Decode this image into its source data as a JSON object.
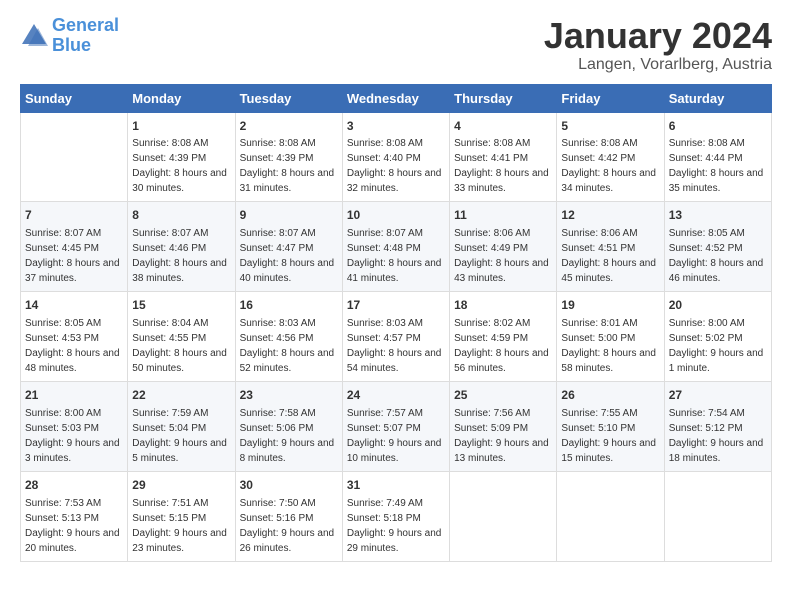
{
  "header": {
    "logo_general": "General",
    "logo_blue": "Blue",
    "month": "January 2024",
    "location": "Langen, Vorarlberg, Austria"
  },
  "weekdays": [
    "Sunday",
    "Monday",
    "Tuesday",
    "Wednesday",
    "Thursday",
    "Friday",
    "Saturday"
  ],
  "weeks": [
    [
      {
        "day": "",
        "sunrise": "",
        "sunset": "",
        "daylight": ""
      },
      {
        "day": "1",
        "sunrise": "Sunrise: 8:08 AM",
        "sunset": "Sunset: 4:39 PM",
        "daylight": "Daylight: 8 hours and 30 minutes."
      },
      {
        "day": "2",
        "sunrise": "Sunrise: 8:08 AM",
        "sunset": "Sunset: 4:39 PM",
        "daylight": "Daylight: 8 hours and 31 minutes."
      },
      {
        "day": "3",
        "sunrise": "Sunrise: 8:08 AM",
        "sunset": "Sunset: 4:40 PM",
        "daylight": "Daylight: 8 hours and 32 minutes."
      },
      {
        "day": "4",
        "sunrise": "Sunrise: 8:08 AM",
        "sunset": "Sunset: 4:41 PM",
        "daylight": "Daylight: 8 hours and 33 minutes."
      },
      {
        "day": "5",
        "sunrise": "Sunrise: 8:08 AM",
        "sunset": "Sunset: 4:42 PM",
        "daylight": "Daylight: 8 hours and 34 minutes."
      },
      {
        "day": "6",
        "sunrise": "Sunrise: 8:08 AM",
        "sunset": "Sunset: 4:44 PM",
        "daylight": "Daylight: 8 hours and 35 minutes."
      }
    ],
    [
      {
        "day": "7",
        "sunrise": "Sunrise: 8:07 AM",
        "sunset": "Sunset: 4:45 PM",
        "daylight": "Daylight: 8 hours and 37 minutes."
      },
      {
        "day": "8",
        "sunrise": "Sunrise: 8:07 AM",
        "sunset": "Sunset: 4:46 PM",
        "daylight": "Daylight: 8 hours and 38 minutes."
      },
      {
        "day": "9",
        "sunrise": "Sunrise: 8:07 AM",
        "sunset": "Sunset: 4:47 PM",
        "daylight": "Daylight: 8 hours and 40 minutes."
      },
      {
        "day": "10",
        "sunrise": "Sunrise: 8:07 AM",
        "sunset": "Sunset: 4:48 PM",
        "daylight": "Daylight: 8 hours and 41 minutes."
      },
      {
        "day": "11",
        "sunrise": "Sunrise: 8:06 AM",
        "sunset": "Sunset: 4:49 PM",
        "daylight": "Daylight: 8 hours and 43 minutes."
      },
      {
        "day": "12",
        "sunrise": "Sunrise: 8:06 AM",
        "sunset": "Sunset: 4:51 PM",
        "daylight": "Daylight: 8 hours and 45 minutes."
      },
      {
        "day": "13",
        "sunrise": "Sunrise: 8:05 AM",
        "sunset": "Sunset: 4:52 PM",
        "daylight": "Daylight: 8 hours and 46 minutes."
      }
    ],
    [
      {
        "day": "14",
        "sunrise": "Sunrise: 8:05 AM",
        "sunset": "Sunset: 4:53 PM",
        "daylight": "Daylight: 8 hours and 48 minutes."
      },
      {
        "day": "15",
        "sunrise": "Sunrise: 8:04 AM",
        "sunset": "Sunset: 4:55 PM",
        "daylight": "Daylight: 8 hours and 50 minutes."
      },
      {
        "day": "16",
        "sunrise": "Sunrise: 8:03 AM",
        "sunset": "Sunset: 4:56 PM",
        "daylight": "Daylight: 8 hours and 52 minutes."
      },
      {
        "day": "17",
        "sunrise": "Sunrise: 8:03 AM",
        "sunset": "Sunset: 4:57 PM",
        "daylight": "Daylight: 8 hours and 54 minutes."
      },
      {
        "day": "18",
        "sunrise": "Sunrise: 8:02 AM",
        "sunset": "Sunset: 4:59 PM",
        "daylight": "Daylight: 8 hours and 56 minutes."
      },
      {
        "day": "19",
        "sunrise": "Sunrise: 8:01 AM",
        "sunset": "Sunset: 5:00 PM",
        "daylight": "Daylight: 8 hours and 58 minutes."
      },
      {
        "day": "20",
        "sunrise": "Sunrise: 8:00 AM",
        "sunset": "Sunset: 5:02 PM",
        "daylight": "Daylight: 9 hours and 1 minute."
      }
    ],
    [
      {
        "day": "21",
        "sunrise": "Sunrise: 8:00 AM",
        "sunset": "Sunset: 5:03 PM",
        "daylight": "Daylight: 9 hours and 3 minutes."
      },
      {
        "day": "22",
        "sunrise": "Sunrise: 7:59 AM",
        "sunset": "Sunset: 5:04 PM",
        "daylight": "Daylight: 9 hours and 5 minutes."
      },
      {
        "day": "23",
        "sunrise": "Sunrise: 7:58 AM",
        "sunset": "Sunset: 5:06 PM",
        "daylight": "Daylight: 9 hours and 8 minutes."
      },
      {
        "day": "24",
        "sunrise": "Sunrise: 7:57 AM",
        "sunset": "Sunset: 5:07 PM",
        "daylight": "Daylight: 9 hours and 10 minutes."
      },
      {
        "day": "25",
        "sunrise": "Sunrise: 7:56 AM",
        "sunset": "Sunset: 5:09 PM",
        "daylight": "Daylight: 9 hours and 13 minutes."
      },
      {
        "day": "26",
        "sunrise": "Sunrise: 7:55 AM",
        "sunset": "Sunset: 5:10 PM",
        "daylight": "Daylight: 9 hours and 15 minutes."
      },
      {
        "day": "27",
        "sunrise": "Sunrise: 7:54 AM",
        "sunset": "Sunset: 5:12 PM",
        "daylight": "Daylight: 9 hours and 18 minutes."
      }
    ],
    [
      {
        "day": "28",
        "sunrise": "Sunrise: 7:53 AM",
        "sunset": "Sunset: 5:13 PM",
        "daylight": "Daylight: 9 hours and 20 minutes."
      },
      {
        "day": "29",
        "sunrise": "Sunrise: 7:51 AM",
        "sunset": "Sunset: 5:15 PM",
        "daylight": "Daylight: 9 hours and 23 minutes."
      },
      {
        "day": "30",
        "sunrise": "Sunrise: 7:50 AM",
        "sunset": "Sunset: 5:16 PM",
        "daylight": "Daylight: 9 hours and 26 minutes."
      },
      {
        "day": "31",
        "sunrise": "Sunrise: 7:49 AM",
        "sunset": "Sunset: 5:18 PM",
        "daylight": "Daylight: 9 hours and 29 minutes."
      },
      {
        "day": "",
        "sunrise": "",
        "sunset": "",
        "daylight": ""
      },
      {
        "day": "",
        "sunrise": "",
        "sunset": "",
        "daylight": ""
      },
      {
        "day": "",
        "sunrise": "",
        "sunset": "",
        "daylight": ""
      }
    ]
  ]
}
